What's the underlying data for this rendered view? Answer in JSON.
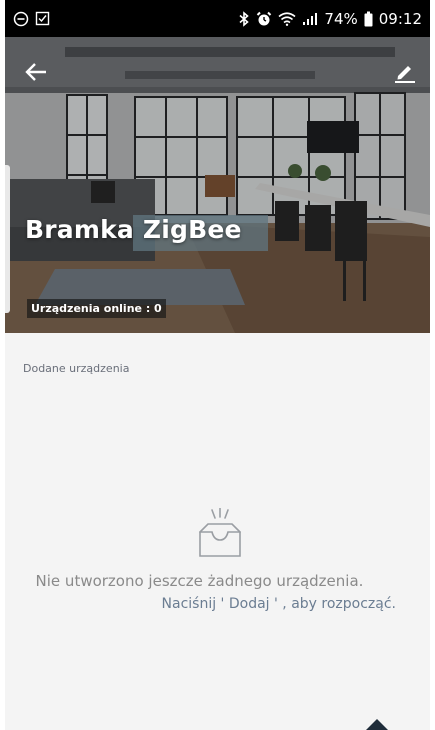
{
  "status_bar": {
    "battery": "74%",
    "time": "09:12"
  },
  "header": {
    "title": "Bramka ZigBee",
    "online_label": "Urządzenia online : 0"
  },
  "devices": {
    "section_label": "Dodane urządzenia",
    "empty_message": "Nie utworzono jeszcze żadnego urządzenia.",
    "empty_hint": "Naciśnij ' Dodaj ' , aby rozpocząć."
  },
  "icons": {
    "back": "back-arrow-icon",
    "edit": "pencil-icon",
    "empty": "empty-tray-icon"
  },
  "colors": {
    "background": "#f4f4f4",
    "status_bar": "#000000",
    "hint_text": "#6b7d92",
    "muted_text": "#8a8a8a"
  }
}
